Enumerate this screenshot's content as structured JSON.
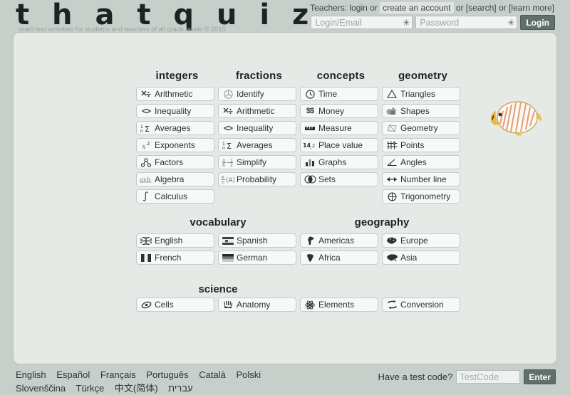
{
  "site": {
    "logo": "t h a t q u i z",
    "tagline": "math test activities for students and teachers of all grade levels © 2015"
  },
  "header": {
    "teachers_prefix": "Teachers: login or",
    "create_account": "create an account",
    "or_1": "or",
    "search": "[search]",
    "or_2": "or",
    "learn_more": "[learn more]",
    "login_placeholder": "Login/Email",
    "password_placeholder": "Password",
    "login_button": "Login",
    "asterisk_icon": "✳"
  },
  "columns": [
    {
      "heading": "integers",
      "items": [
        {
          "label": "Arithmetic",
          "icon": "multiply-divide-icon"
        },
        {
          "label": "Inequality",
          "icon": "less-greater-icon"
        },
        {
          "label": "Averages",
          "icon": "sigma-icon"
        },
        {
          "label": "Exponents",
          "icon": "x-squared-icon"
        },
        {
          "label": "Factors",
          "icon": "factor-tree-icon"
        },
        {
          "label": "Algebra",
          "icon": "algebra-icon"
        },
        {
          "label": "Calculus",
          "icon": "integral-icon"
        }
      ]
    },
    {
      "heading": "fractions",
      "items": [
        {
          "label": "Identify",
          "icon": "pie-slice-icon"
        },
        {
          "label": "Arithmetic",
          "icon": "multiply-divide-icon"
        },
        {
          "label": "Inequality",
          "icon": "less-greater-icon"
        },
        {
          "label": "Averages",
          "icon": "sigma-icon"
        },
        {
          "label": "Simplify",
          "icon": "simplify-fraction-icon"
        },
        {
          "label": "Probability",
          "icon": "probability-icon"
        }
      ]
    },
    {
      "heading": "concepts",
      "items": [
        {
          "label": "Time",
          "icon": "clock-icon"
        },
        {
          "label": "Money",
          "icon": "dollar-icon"
        },
        {
          "label": "Measure",
          "icon": "ruler-icon"
        },
        {
          "label": "Place value",
          "icon": "place-value-icon"
        },
        {
          "label": "Graphs",
          "icon": "bar-chart-icon"
        },
        {
          "label": "Sets",
          "icon": "venn-icon"
        }
      ]
    },
    {
      "heading": "geometry",
      "items": [
        {
          "label": "Triangles",
          "icon": "triangle-icon"
        },
        {
          "label": "Shapes",
          "icon": "shapes-icon"
        },
        {
          "label": "Geometry",
          "icon": "quadrilateral-icon"
        },
        {
          "label": "Points",
          "icon": "grid-points-icon"
        },
        {
          "label": "Angles",
          "icon": "angle-icon"
        },
        {
          "label": "Number line",
          "icon": "arrows-icon"
        },
        {
          "label": "Trigonometry",
          "icon": "circle-cross-icon"
        }
      ]
    }
  ],
  "vocabulary": {
    "heading": "vocabulary",
    "items": [
      {
        "label": "English",
        "icon": "uk-flag-icon"
      },
      {
        "label": "Spanish",
        "icon": "spain-flag-icon"
      },
      {
        "label": "French",
        "icon": "france-flag-icon"
      },
      {
        "label": "German",
        "icon": "germany-flag-icon"
      }
    ]
  },
  "geography": {
    "heading": "geography",
    "items": [
      {
        "label": "Americas",
        "icon": "americas-icon"
      },
      {
        "label": "Europe",
        "icon": "europe-icon"
      },
      {
        "label": "Africa",
        "icon": "africa-icon"
      },
      {
        "label": "Asia",
        "icon": "asia-icon"
      }
    ]
  },
  "science": {
    "heading": "science",
    "items": [
      {
        "label": "Cells",
        "icon": "cell-icon"
      },
      {
        "label": "Anatomy",
        "icon": "hand-bones-icon"
      },
      {
        "label": "Elements",
        "icon": "atom-icon"
      },
      {
        "label": "Conversion",
        "icon": "convert-arrows-icon"
      }
    ]
  },
  "decoration": {
    "image": "tropical-fish-image"
  },
  "footer": {
    "languages": [
      "English",
      "Español",
      "Français",
      "Português",
      "Català",
      "Polski",
      "Slovenščina",
      "Türkçe",
      "中文(简体)",
      "עברית"
    ],
    "testcode_label": "Have a test code?",
    "testcode_placeholder": "TestCode",
    "enter_button": "Enter"
  },
  "colors": {
    "page_background": "#c6cfca",
    "panel_background": "#e6eae7",
    "tile_background": "#f7f8f8",
    "button_green": "#5f7169",
    "text": "#2b3331"
  }
}
